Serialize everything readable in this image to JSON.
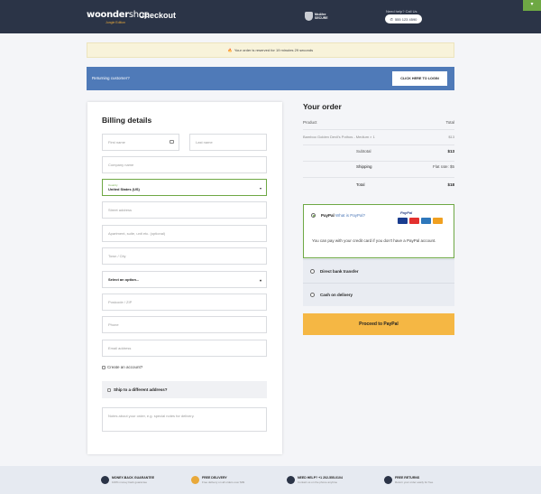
{
  "header": {
    "logo_main": "woonder",
    "logo_shop": "shop",
    "logo_sub": "Jungle Edition",
    "page_title": "Checkout",
    "secure_line1": "McAfee",
    "secure_line2": "SECURE",
    "help_text": "Need help? Call Us",
    "phone": "555 123 4590",
    "corner_icon": "chevron-down-icon"
  },
  "notice": {
    "icon": "fire-icon",
    "text": "Your order is reserved for 19 minutes 29 seconds"
  },
  "returning": {
    "label": "Returning customer?",
    "button": "CLICK HERE TO LOGIN"
  },
  "billing": {
    "title": "Billing details",
    "first_name": "First name",
    "last_name": "Last name",
    "company": "Company name",
    "country_label": "Country",
    "country_value": "United States (US)",
    "street": "Street address",
    "apartment": "Apartment, suite, unit etc. (optional)",
    "town": "Town / City",
    "state_select": "Select an option...",
    "postcode": "Postcode / ZIP",
    "phone": "Phone",
    "email": "Email address",
    "create_account": "Create an account?",
    "ship_different": "Ship to a different address?",
    "notes": "Notes about your order, e.g. special notes for delivery."
  },
  "order": {
    "title": "Your order",
    "col_product": "Product",
    "col_total": "Total",
    "item_name": "Bamboo Golden Devil's Pothos - Medium × 1",
    "item_price": "$13",
    "subtotal_label": "Subtotal",
    "subtotal_value": "$13",
    "shipping_label": "Shipping",
    "shipping_value": "Flat rate: $5",
    "total_label": "Total",
    "total_value": "$18"
  },
  "payment": {
    "paypal_label": "PayPal",
    "paypal_what": "What is PayPal?",
    "paypal_brand": "PayPal",
    "paypal_desc": "You can pay with your credit card if you don't have a PayPal account.",
    "bank": "Direct bank transfer",
    "cod": "Cash on delivery",
    "proceed": "Proceed to PayPal",
    "accent": "#6ea844",
    "button_color": "#f5b744"
  },
  "footer": [
    {
      "title": "MONEY-BACK GUARANTEE",
      "sub": "100% money back guarantee",
      "icon": "money-icon"
    },
    {
      "title": "FREE DELIVERY",
      "sub": "Free delivery on all orders over $99",
      "icon": "box-icon"
    },
    {
      "title": "NEED HELP? +1 202-555-0104",
      "sub": "Contact us on the phone anytime",
      "icon": "phone-icon"
    },
    {
      "title": "FREE RETURNS",
      "sub": "Return your order easily for free",
      "icon": "refresh-icon"
    }
  ]
}
